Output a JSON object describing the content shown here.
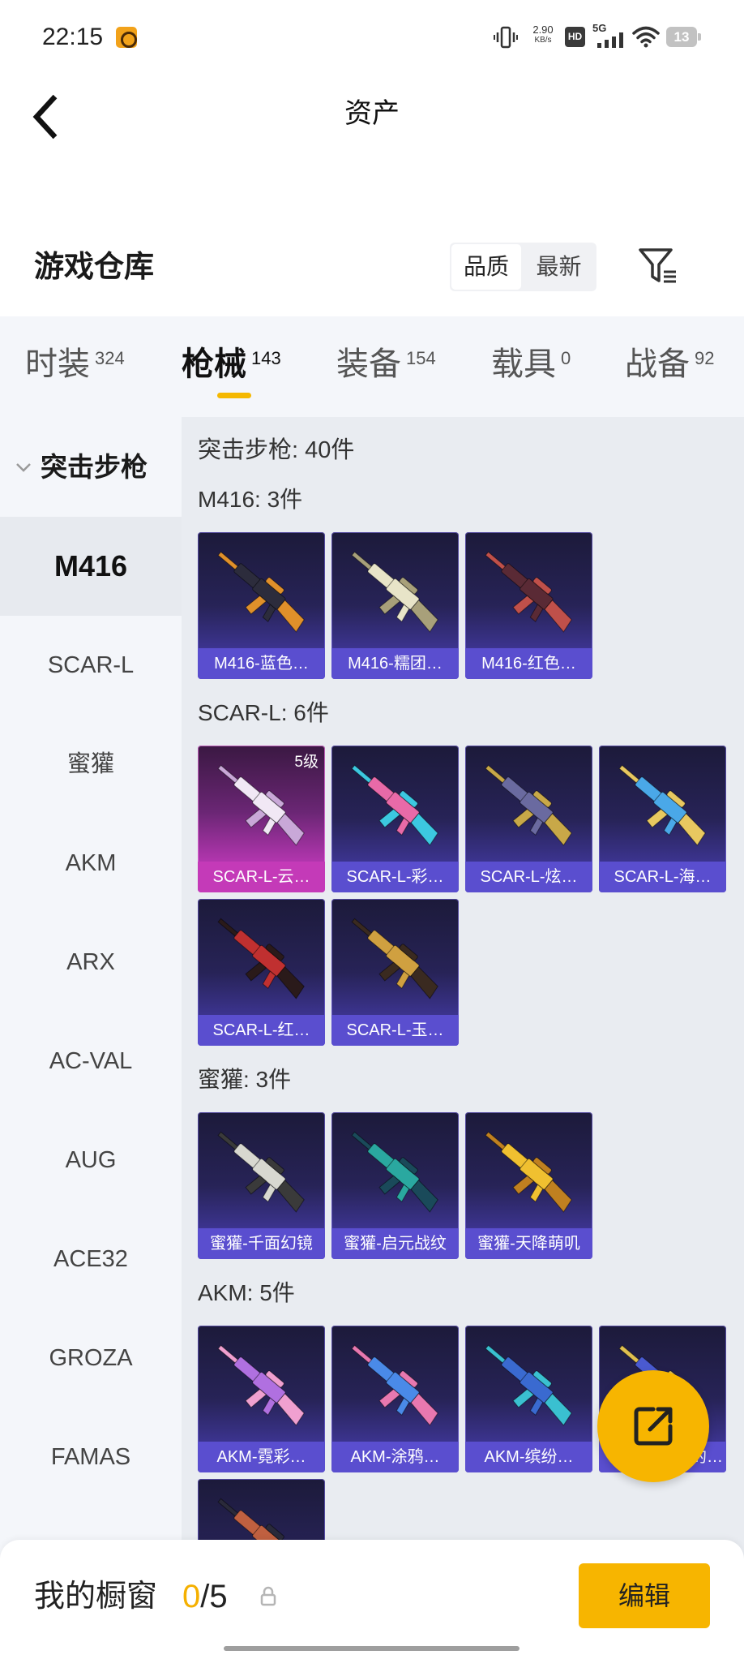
{
  "status_bar": {
    "time": "22:15",
    "net_speed": "2.90",
    "net_speed_unit": "KB/s",
    "hd_label": "HD",
    "network_label": "5G",
    "battery_level": "13",
    "icons": [
      "app-notification-icon",
      "vibrate-icon",
      "signal-icon",
      "wifi-icon",
      "battery-icon"
    ]
  },
  "header": {
    "title": "资产",
    "back_icon": "chevron-left-icon"
  },
  "warehouse": {
    "title": "游戏仓库",
    "sort_options": [
      {
        "label": "品质",
        "selected": true
      },
      {
        "label": "最新",
        "selected": false
      }
    ],
    "filter_icon": "filter-icon"
  },
  "tabs": [
    {
      "label": "时装",
      "count": "324",
      "active": false
    },
    {
      "label": "枪械",
      "count": "143",
      "active": true
    },
    {
      "label": "装备",
      "count": "154",
      "active": false
    },
    {
      "label": "载具",
      "count": "0",
      "active": false
    },
    {
      "label": "战备",
      "count": "92",
      "active": false
    }
  ],
  "sidebar": {
    "category": "突击步枪",
    "category_icon": "chevron-down-icon",
    "items": [
      {
        "label": "M416",
        "selected": true
      },
      {
        "label": "SCAR-L",
        "selected": false
      },
      {
        "label": "蜜獾",
        "selected": false
      },
      {
        "label": "AKM",
        "selected": false
      },
      {
        "label": "ARX",
        "selected": false
      },
      {
        "label": "AC-VAL",
        "selected": false
      },
      {
        "label": "AUG",
        "selected": false
      },
      {
        "label": "ACE32",
        "selected": false
      },
      {
        "label": "GROZA",
        "selected": false
      },
      {
        "label": "FAMAS",
        "selected": false
      }
    ]
  },
  "content": {
    "category_title": "突击步枪: 40件",
    "sections": [
      {
        "title": "M416: 3件",
        "items": [
          {
            "label": "M416-蓝色…",
            "colors": [
              "#2c2c3c",
              "#e0902a"
            ]
          },
          {
            "label": "M416-糯团…",
            "colors": [
              "#e8e4c8",
              "#a8a07a"
            ]
          },
          {
            "label": "M416-红色…",
            "colors": [
              "#5a2a35",
              "#c0504a"
            ]
          }
        ]
      },
      {
        "title": "SCAR-L: 6件",
        "items": [
          {
            "label": "SCAR-L-云…",
            "badge": "5级",
            "frame_color": "#c43ab8",
            "colors": [
              "#f1e8f5",
              "#c9a8d8"
            ]
          },
          {
            "label": "SCAR-L-彩…",
            "colors": [
              "#e86aa8",
              "#3cc8e0"
            ]
          },
          {
            "label": "SCAR-L-炫…",
            "colors": [
              "#6a6aa0",
              "#c8a848"
            ]
          },
          {
            "label": "SCAR-L-海…",
            "colors": [
              "#4aa8e8",
              "#e8c860"
            ]
          },
          {
            "label": "SCAR-L-红…",
            "colors": [
              "#c03030",
              "#2a1a1a"
            ]
          },
          {
            "label": "SCAR-L-玉…",
            "colors": [
              "#d0a040",
              "#3a2a20"
            ]
          }
        ]
      },
      {
        "title": "蜜獾: 3件",
        "items": [
          {
            "label": "蜜獾-千面幻镜",
            "colors": [
              "#d8d8d0",
              "#3a3a3a"
            ]
          },
          {
            "label": "蜜獾-启元战纹",
            "colors": [
              "#2aa8a0",
              "#1a4a5a"
            ]
          },
          {
            "label": "蜜獾-天降萌叽",
            "colors": [
              "#f0c030",
              "#c08020"
            ]
          }
        ]
      },
      {
        "title": "AKM: 5件",
        "items": [
          {
            "label": "AKM-霓彩…",
            "colors": [
              "#b070e0",
              "#f0a0d0"
            ]
          },
          {
            "label": "AKM-涂鸦…",
            "colors": [
              "#4a8ae8",
              "#e878b0"
            ]
          },
          {
            "label": "AKM-缤纷…",
            "colors": [
              "#3a6ad0",
              "#3ac0d0"
            ]
          },
          {
            "label": "A",
            "label_tail": "的…",
            "colors": [
              "#4a5ad0",
              "#e0c050"
            ]
          },
          {
            "colors": [
              "#c06040",
              "#2a2a3a"
            ]
          }
        ]
      }
    ]
  },
  "share_button": {
    "icon": "share-icon"
  },
  "showcase": {
    "label": "我的橱窗",
    "count": "0",
    "total": "/5",
    "lock_icon": "lock-icon",
    "edit_label": "编辑"
  },
  "colors": {
    "accent": "#f7b500",
    "card_purple": "#5a4ecf",
    "card_pink": "#c43ab8",
    "content_bg": "#e9ecf1",
    "sidebar_bg": "#f4f6fa"
  }
}
